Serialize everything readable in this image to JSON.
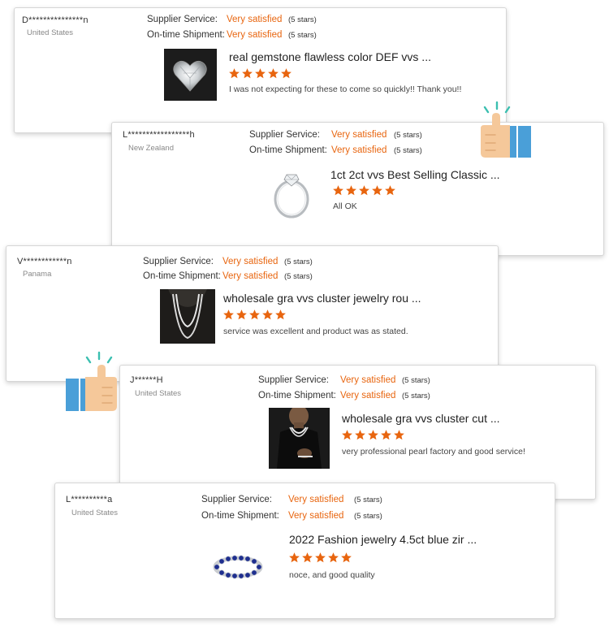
{
  "labels": {
    "supplier_service": "Supplier Service:",
    "ontime_shipment": "On-time Shipment:"
  },
  "colors": {
    "accent": "#e8650f",
    "star": "#e8650f",
    "thumb_skin": "#f5c89a",
    "thumb_cuff": "#4a9fd8",
    "sparkle": "#3bbfb0"
  },
  "icons": [
    "thumbs-up-icon",
    "star-icon"
  ],
  "reviews": [
    {
      "buyer": "D***************n",
      "country": "United States",
      "supplier_rating": "Very satisfied",
      "supplier_stars": "(5 stars)",
      "shipment_rating": "Very satisfied",
      "shipment_stars": "(5 stars)",
      "product_title": "real gemstone flawless color DEF vvs  ...",
      "product_rating": 5,
      "comment": "I was not expecting for these to come so quickly!! Thank you!!"
    },
    {
      "buyer": "L*****************h",
      "country": "New Zealand",
      "supplier_rating": "Very satisfied",
      "supplier_stars": "(5 stars)",
      "shipment_rating": "Very satisfied",
      "shipment_stars": "(5 stars)",
      "product_title": "1ct 2ct vvs Best Selling Classic  ...",
      "product_rating": 5,
      "comment": "All OK"
    },
    {
      "buyer": "V************n",
      "country": "Panama",
      "supplier_rating": "Very satisfied",
      "supplier_stars": "(5 stars)",
      "shipment_rating": "Very satisfied",
      "shipment_stars": "(5 stars)",
      "product_title": "wholesale gra vvs cluster jewelry rou  ...",
      "product_rating": 5,
      "comment": "service was excellent and product was as stated."
    },
    {
      "buyer": "J******H",
      "country": "United States",
      "supplier_rating": "Very satisfied",
      "supplier_stars": "(5 stars)",
      "shipment_rating": "Very satisfied",
      "shipment_stars": "(5 stars)",
      "product_title": "wholesale gra vvs cluster cut  ...",
      "product_rating": 5,
      "comment": "very professional pearl factory and good service!"
    },
    {
      "buyer": "L**********a",
      "country": "United States",
      "supplier_rating": "Very satisfied",
      "supplier_stars": "(5 stars)",
      "shipment_rating": "Very satisfied",
      "shipment_stars": "(5 stars)",
      "product_title": "2022 Fashion jewelry 4.5ct blue zir  ...",
      "product_rating": 5,
      "comment": "noce, and good quality"
    }
  ]
}
